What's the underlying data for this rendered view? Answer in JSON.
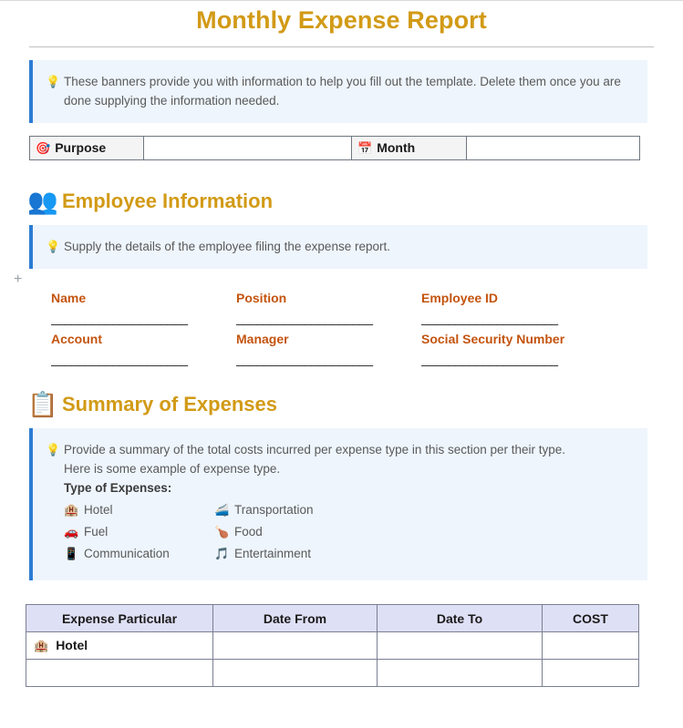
{
  "document": {
    "title": "Monthly Expense Report"
  },
  "intro_banner": {
    "icon": "lightbulb-icon",
    "text": "These banners provide you with information to help you fill out the template. Delete them once you are done supplying the information needed."
  },
  "meta_table": {
    "purpose": {
      "icon": "dart-target-icon",
      "emoji": "🎯",
      "label": "Purpose",
      "value": ""
    },
    "month": {
      "icon": "calendar-icon",
      "emoji": "🗓",
      "label": "Month",
      "value": ""
    }
  },
  "employee_section": {
    "icon": "people-group-icon",
    "emoji": "👥",
    "heading": "Employee Information",
    "banner": {
      "icon": "lightbulb-icon",
      "text": "Supply the details of the employee filing the expense report."
    },
    "fields": [
      {
        "label": "Name",
        "value": "",
        "line": "____________________"
      },
      {
        "label": "Position",
        "value": "",
        "line": "____________________"
      },
      {
        "label": "Employee ID",
        "value": "",
        "line": "____________________"
      },
      {
        "label": "Account",
        "value": "",
        "line": "____________________"
      },
      {
        "label": "Manager",
        "value": "",
        "line": "____________________"
      },
      {
        "label": "Social Security Number",
        "value": "",
        "line": "____________________"
      }
    ]
  },
  "summary_section": {
    "icon": "clipboard-icon",
    "emoji": "📋",
    "heading": "Summary of Expenses",
    "banner": {
      "icon": "lightbulb-icon",
      "line1": "Provide a summary of the total costs incurred per expense type in this section per their type.",
      "line2": "Here is some example of expense type.",
      "subheading": "Type of Expenses:",
      "types": [
        {
          "emoji": "🏨",
          "icon": "hotel-icon",
          "label": "Hotel"
        },
        {
          "emoji": "🚄",
          "icon": "train-icon",
          "label": "Transportation"
        },
        {
          "emoji": "🚗",
          "icon": "car-icon",
          "label": "Fuel"
        },
        {
          "emoji": "🍗",
          "icon": "poultry-leg-icon",
          "label": "Food"
        },
        {
          "emoji": "📱",
          "icon": "mobile-phone-icon",
          "label": "Communication"
        },
        {
          "emoji": "🎵",
          "icon": "music-note-icon",
          "label": "Entertainment"
        }
      ]
    }
  },
  "expense_table": {
    "columns": [
      "Expense Particular",
      "Date From",
      "Date To",
      "COST"
    ],
    "rows": [
      {
        "emoji": "🏨",
        "icon": "hotel-icon",
        "particular": "Hotel",
        "date_from": "",
        "date_to": "",
        "cost": ""
      },
      {
        "emoji": "",
        "icon": "",
        "particular": "",
        "date_from": "",
        "date_to": "",
        "cost": ""
      }
    ]
  },
  "editor": {
    "insert_marker": "+"
  },
  "colors": {
    "title_gold": "#D29A16",
    "label_orange": "#C4540F",
    "banner_blue_bar": "#2B7CD3",
    "banner_background": "#EEF5FD",
    "table_header_lavender": "#DEE0F5",
    "table_border": "#7B7F93"
  }
}
